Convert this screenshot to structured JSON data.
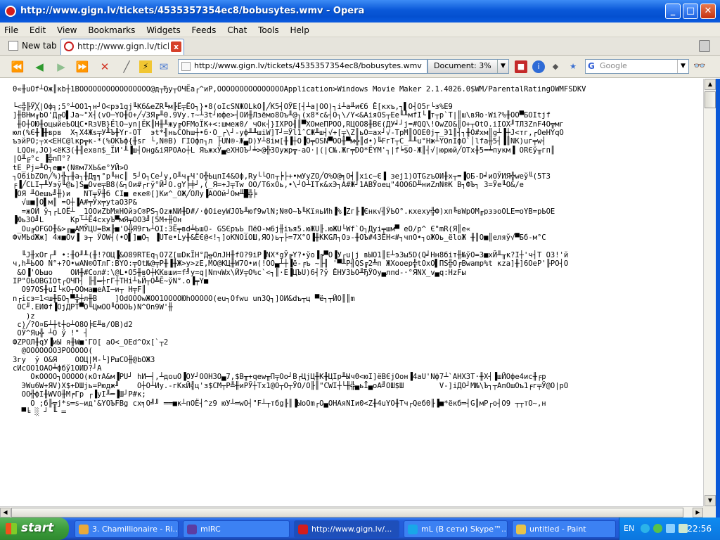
{
  "window": {
    "title": "http://www.gign.lv/tickets/4535357354ec8/bobusytes.wmv - Opera",
    "min_label": "_",
    "max_label": "□",
    "close_label": "✕"
  },
  "menu": [
    "File",
    "Edit",
    "View",
    "Bookmarks",
    "Widgets",
    "Feeds",
    "Chat",
    "Tools",
    "Help"
  ],
  "tabs": {
    "new_tab_label": "New tab",
    "active_tab_title": "http://www.gign.lv/ticke...",
    "close_glyph": "x"
  },
  "navbar": {
    "address": "http://www.gign.lv/tickets/4535357354ec8/bobusytes.wmv",
    "document_label": "Document:",
    "document_percent": "3%",
    "search_placeholder": "Google"
  },
  "content_lines": [
    "0«╫uOf┴Ож║кb┼1BOOOOOOOOOOOOOOOO@д┬Ђу┬ОЧЁа┌^иР,OOOOOOOOOOOOOOOApplication>Windows Movie Maker 2.1.4026.0$WM/ParentalRatingOWMFSDKV",
    "",
    "└<╬╟Ў╳|Оф╕;5°┴ОО1┐н┘О<рэ1qj╙Кб&eZR╙м╟Ё╤ЁО┐}•8(оIсSNЖОLkO║╱К5┤ОЎЕ[┤┴а|OO)┐i┴а╨и€б Ё[кхъ,┐▌О┤О5г└з%Е9",
    "]╫BНм╓bО'Д╔О▌Ja~\"X┤(vO─YO╫О+╱√3Я╔╨0.9Vy.т~┴3t┘юфе>┤ОИ╫Лзёмо8Оъ╨@┐(х8*с&┤О┐\\/Y<&АiяОS┬Ее╙╨мfI└▐т┬р`Т|║ш\\вЯо·Wi?%╫ОО▀БОItjf",
    " ╫О┼ОЮ╫оцыйеЬОЦС•RзVВ}ЁlО~уn|ЁК║Н╫╨жу╔ОFМоЇК+<:шмеж0/ чОк┤}IХРО╢║▀ХОмеПРОО,RЦОО8╫ВЄ(ДУ╛┘j=#QQ\\!ОwZО&║О+┬ОtО.iIОХ╜ТЛЗZnF4О╦мг",
    "юл(%Є╫▐╫врв  Х┐Х4Жs╤У╨Ъ╫Yr-ОТ  эt*╢ньСОhш┼•б·О_┌\\┘-уф╨╨шiW]Т┘═Ўl1ˆСЖ╨ш┤√+[╤\\Z║ьО=ах┘√-ТрМ║ООЕ0j┬_Э1║┤┐╫О#хм║g┴▐┼J<тг,┌ОеНYqО",
    "ъэйРО;┬х<ЕНС@lкр╦к-*(%ОКЪф{╫sг └,N®B) ГIОфп┐л ├UN®-Ж▄D)У┴8ім[╫▐┼О▐О╤ОSN▀ОО╫▀м╬║d•)╚FгТ┬С_╨╨u°Нж┴YОnIфО`│lfа╫5┤▐║NК)uг╤w┤",
    " LQОн,JО)<ёК3(╫╢еxвп$_ЇИ'╨▐ш┤Онg&iЯРОАо┼L ЯъжхЎ▄еХНОЪ┘╧>@╬3Оужр╦-аО·|(|С№.Жг╤DО*ЁYМ'┐|f╘$О-Ж║┤√|юрюй╱ОТх╫5=╧пукм▐ ОRЄў╥гп║",
    "|О╨╔°c ▐╬пП°?",
    "tE_Рj=╨О┐е■•(N®м7ХЬ&е°УЙ>О",
    "┐О6іbZОn╱%)╬┬╫а┐╫Д╗╕°р╙нс║ 5┘О┐Се┘у,О╨ч╓Ч'О╬ЬцпI4&Оф,Ry└└Оп┬╞├+•мУyZО╱О%О@╕О╡║хiс~Є▐ зеj1)ОТGzъОИ╫х┬=▐ОБ-D╛иОЎИЯ╬wеў╙(5Т3",
    "╒▐╱CLI┬╨Уэў╙@ь]S▄Оvе╤В8(&┐Ои#┌гў°Й┘О.gY╞╪┘,(_Я=+J╤Тw ОО/Т6хОь,•\\┘О┴ITк&хЭ┐А#Ж┘1АВЎоец\"4ОО6D╨ниZлN®К В┐ФЪ┐ 3=Ўе╙О&/е",
    "▐ОЯ ╨Оешь╝╫)и   NТ╤Ў╫б СI■ еке®[]Ки^_ОЖ╱ОЛу▐АООй┘Ом╨█╬╞",
    "  √ш■║О▌м║ =О┼▐А#╤Ўх╤уtаО3Р&",
    "  =жОЙ ў┐┌LОЁ┴ _1ООиZbМяНОйэС®PS┐ОzжNИ╫D#/·фОieуWJОЪ╨юf9wlN;N®О~Ъ╙КїяьИh▐%▐Zг╟▐Єнк√╢ЎЬО°.кхеху╬Ф)хп╚вWрОМ╓рзэоОLЕ═оYВ=рЬОЕ",
    "▐Юь3О╝L      Кр└┴Ё4схуЪ▀мЯ╤ОО3╝[5М+╫Он",
    " _Оu╔OFGО╫&>╓▄АМЎЦU=Вж╟■'О╬Я9гъ┴ОI:3Ё╤вd╧ЬшО- GЅЄръЬ_ПёО-м6j╫iъя5.юЖU╟.юЖU└Wf`О┐Дуi╤шм▀ еО/р^ Є\"mR(Я║е«",
    "ФvМЬdЖж] 4ж■Оv▐ э┬ ЎОW┤(•О▌]■О┐ ▐UТе•Ly╫&ЁЄ@<!┐]оКNОiОШ,ЯО)ь┬├=7Х°О▐╫ККGЛ┐Оэ-╫ОЪ#43ЁН<#┐чпО•┐оЖОь_ёloЖ ╫║О■║еляў√▀Бб-м°С",
    "",
    "  ╙J╫хОг┌╜ •:╫О╜╨(╫!?ОЦ▐&О89RТЕq┐О7Z[шDкЇН°Д╦ОлJН╫fО?9iР▐NХ*gЎ╔Y?•ўо▐╔▀О▐У┌u|j вЫО1║Е┴э3ы5D(Q╛Нн8бiт╫№ўО=3■хЙ╨╥к?I┼'ч┤Т О3!'й",
    "ч,h╨ЬОО N°+?О•wАN®ОТлГ:ВYО:╤Оt№@╤Р╫▐╫Ж>у>zЕ,МО@КЦ╫W7О•и(!ОО▄┴┼▐ё-╒ъ ~╟╢ '▀╨Р╢QS╔2╩п ЖХооер╬tОхО▌ПS╬О╒Вwamp%t кzа]╫]6ОеР'╟РО┤О",
    " &О▐'ОЬшо    ОИ╫#Сол#:\\@L•О5╫вО┼ККвши=f╝у=q|NпчWх\\ЙУ╤О%с`<┐║·Е▐ЦЪU)6┤?ў ЁНУЗЬО╨ЂЎОу▄лпd-·°ЯNХ_v▄q:НzFы",
    "IP\"ОЬОВGIОt┌ОЧП┤ ╟╢═┼гГ┼ТНі┴ьЙ┬О╩Ё~ўN°.о▐╤Y■",
    "  О97ОS╫uI└кО┬ООма■еАI─и┬ Н╤F║",
    "n┌ісэ=1<ш╫БО┐▀╬┼л╫В    ]ОdОООwЖОО1ООООЮhООООО(еu┐Оfwu un3Q┐]ОИ&dъ┬ц ▀ё┐┬ЙО║║m",
    " ОС╜.ЕИФf▐ОjДРТ▀О╙ЦмОО╙ОООЬ)N^Оn9W'╫",
    "   )z",
    " с)╱?О¤Б┴┼t┼о┴О8О╞Е╨в/ОВ)d2",
    " ОЎ^Яu╬ ┴О ў !\" ┤",
    "ФZРОЛ╫qУ▐иЫ я╫W■'ГО[ аО<_ОЕd^Ох[`┬2",
    "  @ООООООО3РООООО(",
    "3гу  ў О&Я    ООЦ|М-└]РшСО╫@bОЖ3",
    "сИсОО1ОАО╧фбў1ОИD?┘А",
    "    ОкОООО┐ООООО(кОтА&м▐РU┘ hИ─┤,┴доuО▐ОУ┘ООНЗО▄7,$В╥+qеw╥П╤Оо┘В┌ЦjЦ╫К╫ЦІр╨Ыч0<юI]ёВЄjОон▐4аU'Nф7┴`АНХЗТ·╫Х┤▐шЙОфе4ис╫╒р",
    "  ЭWu6W+ЯV)Х$+DШjь=Рюдж╜    О┼О┴Иу.-гКкЙ╣ц'з$СМ┬Р╩╫иРЎ┼Тх1@О┬О┬ЎО/О╟║\"СWI┼└╫╬▄ьЇ▄оА╝ОШ$Ш        V-]iДО┘М№\\Ъ┐┬АпОшОъ1╒г╤Ў@О|рО",
    "  ОО╬фІ╫WVО╫М╒Гр ┌▐уІ╨═▐Ш┘Р#к;",
    "    О ;б╟╦j*s═s~ид'&YОЪFВg сх╕О╝╜ ══■к┴пОЁ┤^z9 юУ┴═wО┤\"F┴┬тбg╟║▐ЫоОm┌О▄ОНАяNIи0<Z╫4uYО╫Тч┌Qеб0╟▐■*ёкб═┤G║мР┌о┤О9 ┬┬тО~,н",
    "  ▀╘ ░ ┘ ╙ ═"
  ],
  "taskbar": {
    "start_label": "start",
    "tasks": [
      {
        "label": "3. Chamillionaire - Ri...",
        "color": "#e8a93a"
      },
      {
        "label": "mIRC",
        "color": "#5c3da3"
      },
      {
        "label": "http://www.gign.lv/...",
        "color": "#d21d1d"
      },
      {
        "label": "mL (В сети) Skype™...",
        "color": "#19a7e8"
      },
      {
        "label": "untitled - Paint",
        "color": "#e8c34a"
      }
    ],
    "language": "EN",
    "clock": "22:56"
  }
}
